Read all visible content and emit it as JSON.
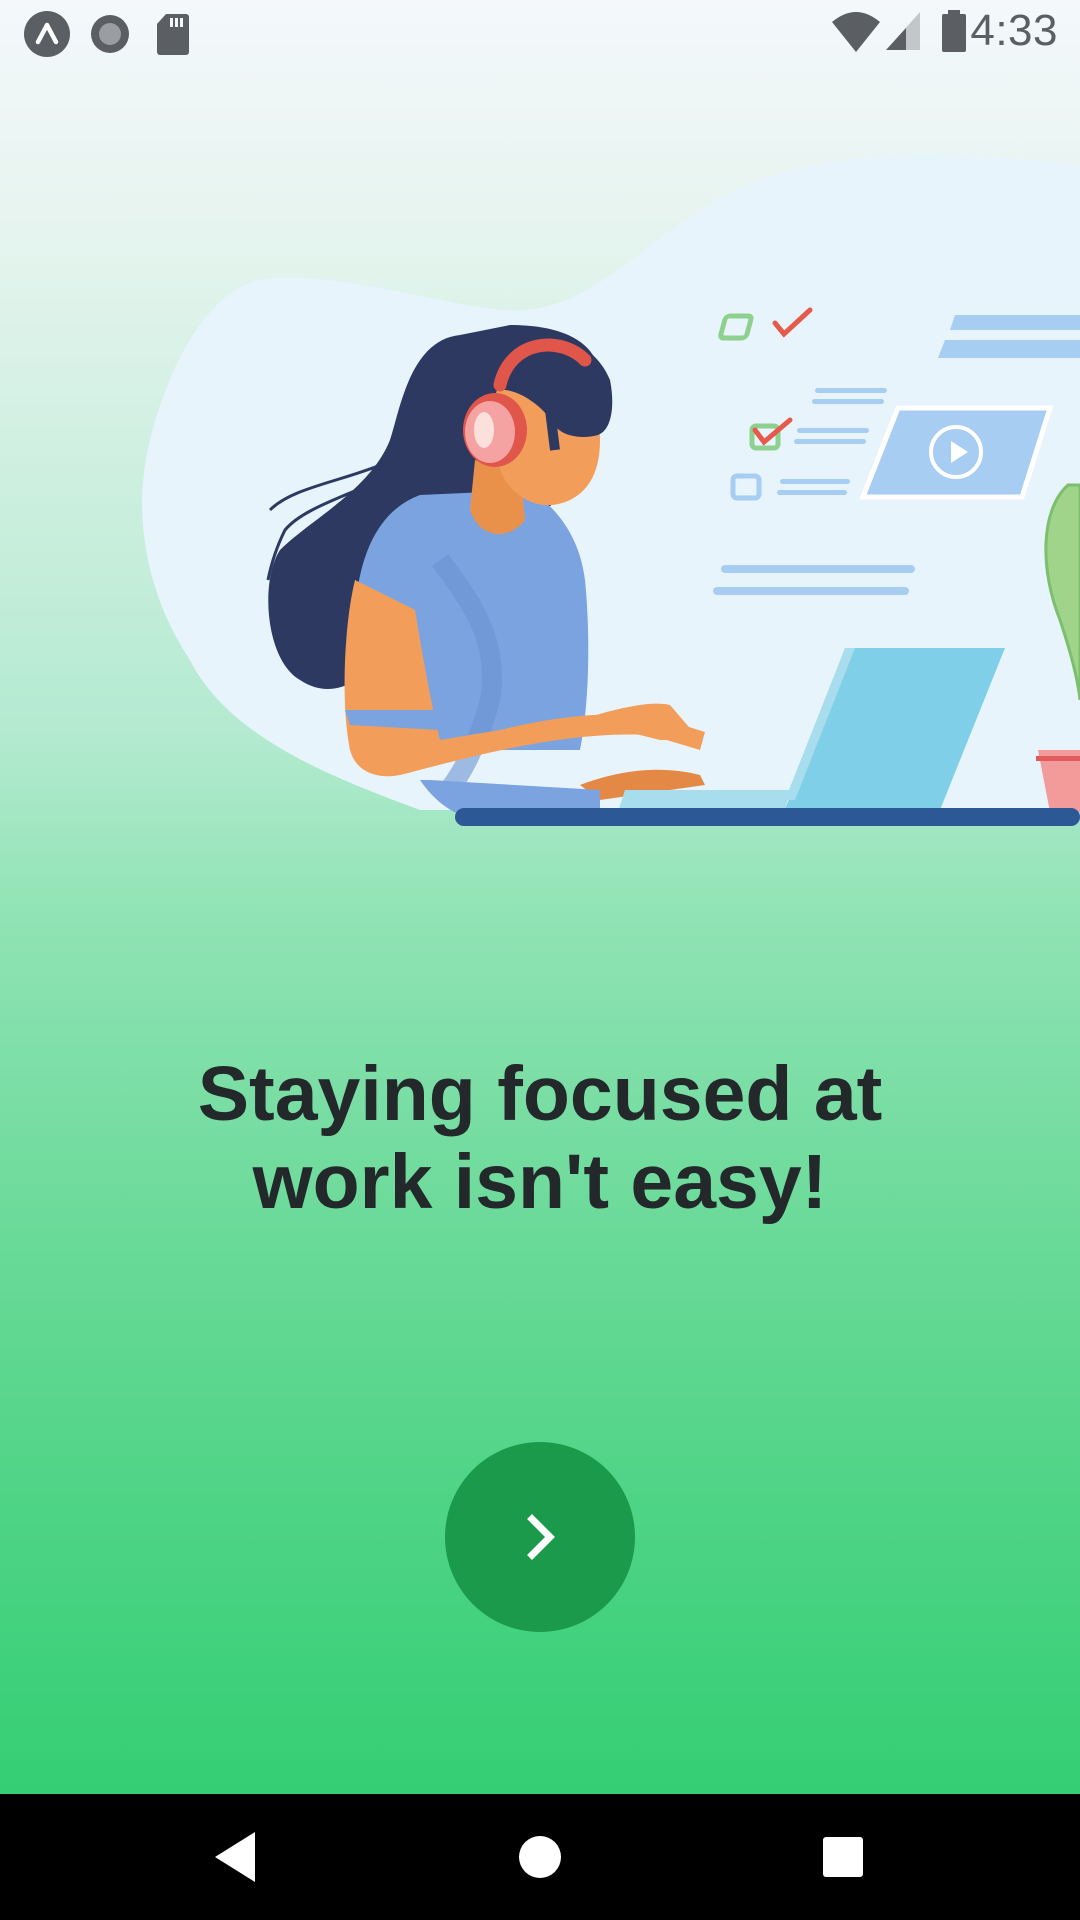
{
  "status_bar": {
    "time": "4:33",
    "left_icons": [
      "app-launcher-icon",
      "record-icon",
      "sd-card-icon"
    ],
    "right_icons": [
      "wifi-icon",
      "cell-signal-icon",
      "battery-icon"
    ]
  },
  "illustration": {
    "subject": "woman-with-headphones-typing-on-laptop",
    "elements": [
      "checklist-icon",
      "video-card-icon",
      "plant-icon",
      "laptop-icon",
      "headphones-icon"
    ]
  },
  "headline": {
    "line1": "Staying focused at",
    "line2": "work isn't easy!"
  },
  "next_button": {
    "icon": "chevron-right-icon",
    "color": "#1a9a4a"
  },
  "nav_bar": {
    "back": "back-icon",
    "home": "home-icon",
    "recents": "recents-icon"
  },
  "colors": {
    "background_top": "#f4f8fb",
    "background_bottom": "#29cc6c",
    "headline_text": "#23282b",
    "button": "#1a9a4a"
  }
}
